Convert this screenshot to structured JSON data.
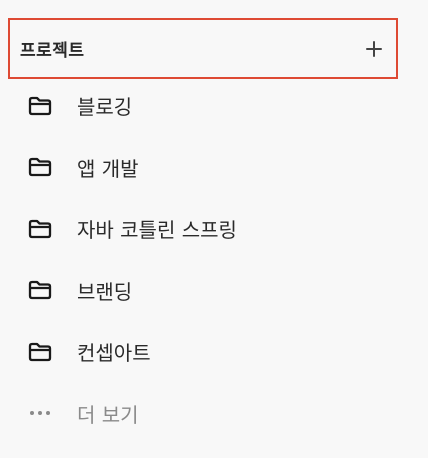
{
  "section": {
    "title": "프로젝트",
    "add_icon": "plus-icon"
  },
  "projects": [
    {
      "label": "블로깅",
      "icon": "folder-icon"
    },
    {
      "label": "앱 개발",
      "icon": "folder-icon"
    },
    {
      "label": "자바 코틀린 스프링",
      "icon": "folder-icon"
    },
    {
      "label": "브랜딩",
      "icon": "folder-icon"
    },
    {
      "label": "컨셉아트",
      "icon": "folder-icon"
    }
  ],
  "more": {
    "label": "더 보기",
    "icon": "more-dots-icon"
  },
  "colors": {
    "highlight_border": "#de4a34",
    "background": "#f8f8f8",
    "muted_text": "#8a8a8a"
  }
}
